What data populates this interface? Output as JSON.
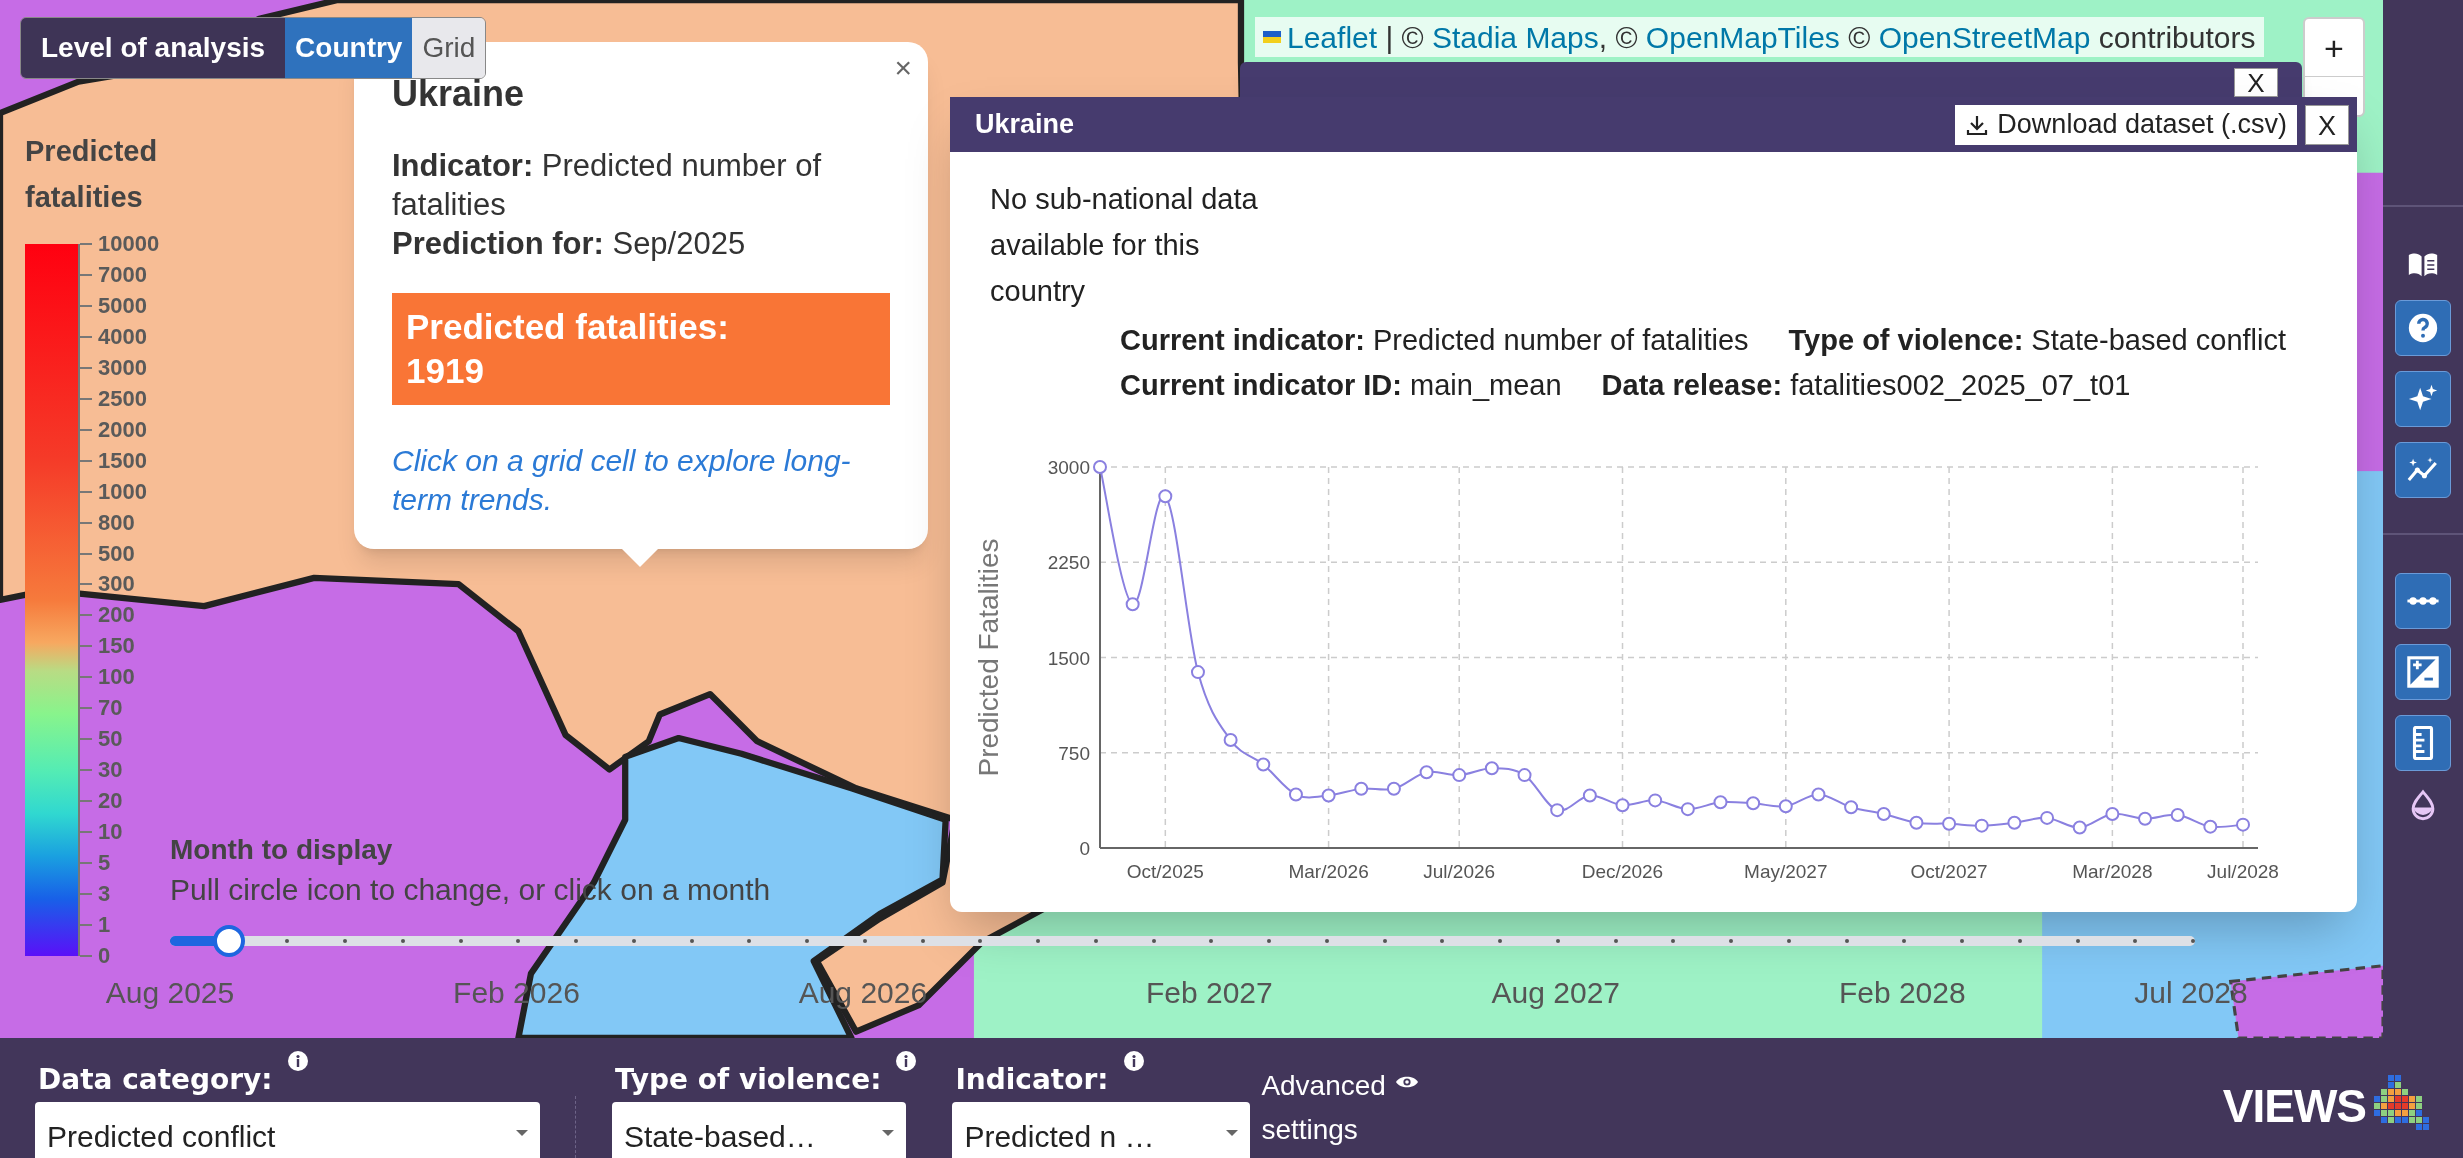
{
  "level_of_analysis": {
    "label": "Level of analysis",
    "options": [
      {
        "label": "Country",
        "selected": true
      },
      {
        "label": "Grid",
        "selected": false
      }
    ]
  },
  "legend": {
    "title": "Predicted fatalities",
    "labels": [
      "10000",
      "7000",
      "5000",
      "4000",
      "3000",
      "2500",
      "2000",
      "1500",
      "1000",
      "800",
      "500",
      "300",
      "200",
      "150",
      "100",
      "70",
      "50",
      "30",
      "20",
      "10",
      "5",
      "3",
      "1",
      "0"
    ]
  },
  "popup": {
    "title": "Ukraine",
    "close": "×",
    "lines": [
      "**Indicator:** Predicted number of fatalities",
      "**Prediction for:** Sep/2025"
    ],
    "highlight": {
      "label": "Predicted fatalities:",
      "value": "1919"
    },
    "link": "Click on a grid cell to explore long-term trends."
  },
  "attribution": [
    {
      "kind": "link",
      "text": "Leaflet"
    },
    {
      "kind": "text",
      "text": " | © "
    },
    {
      "kind": "link",
      "text": "Stadia Maps"
    },
    {
      "kind": "text",
      "text": ", © "
    },
    {
      "kind": "link",
      "text": "OpenMapTiles"
    },
    {
      "kind": "text",
      "text": " © "
    },
    {
      "kind": "link",
      "text": "OpenStreetMap"
    },
    {
      "kind": "text",
      "text": " contributors"
    }
  ],
  "zoom_in": "+",
  "back_panel": {
    "close": "X"
  },
  "chart_panel": {
    "title": "Ukraine",
    "download": "Download dataset (.csv)",
    "close": "X",
    "note": "No sub-national data available for this country",
    "info_rows": [
      [
        "**Current indicator:** Predicted number of fatalities",
        "**Type of violence:** State-based conflict"
      ],
      [
        "**Current indicator ID:** main_mean",
        "**Data release:** fatalities002_2025_07_t01"
      ]
    ],
    "chart_data": {
      "type": "line",
      "ylabel": "Predicted Fatalities",
      "categories": [
        null,
        null,
        "Oct/2025",
        null,
        null,
        null,
        null,
        "Mar/2026",
        null,
        null,
        null,
        "Jul/2026",
        null,
        null,
        null,
        null,
        "Dec/2026",
        null,
        null,
        null,
        null,
        "May/2027",
        null,
        null,
        null,
        null,
        "Oct/2027",
        null,
        null,
        null,
        null,
        "Mar/2028",
        null,
        null,
        null,
        "Jul/2028"
      ],
      "series": [
        {
          "color": "#8a80e0",
          "marker": "circle",
          "values": [
            3000,
            1919,
            2770,
            1385,
            850,
            658,
            421,
            413,
            467,
            467,
            597,
            574,
            628,
            574,
            298,
            413,
            337,
            375,
            306,
            360,
            352,
            329,
            421,
            321,
            268,
            199,
            191,
            176,
            199,
            237,
            161,
            268,
            230,
            260,
            168,
            184
          ]
        }
      ],
      "ylim": [
        0,
        3000
      ],
      "yticks": [
        0,
        750,
        1500,
        2250,
        3000
      ],
      "grid": true
    }
  },
  "month_slider": {
    "title": "Month to display",
    "hint": "Pull circle icon to change, or click on a month",
    "level": 0.029,
    "labels": [
      "Aug 2025",
      "Feb 2026",
      "Aug 2026",
      "Feb 2027",
      "Aug 2027",
      "Feb 2028",
      "Jul 2028"
    ]
  },
  "toolbar": {
    "groups": [
      [
        {
          "kind": "book"
        },
        {
          "kind": "help"
        },
        {
          "kind": "sparkle"
        },
        {
          "kind": "trend"
        }
      ],
      [
        {
          "kind": "dots"
        },
        {
          "kind": "exposure"
        },
        {
          "kind": "ruler"
        },
        {
          "kind": "drop"
        }
      ]
    ]
  },
  "filters": [
    {
      "kind": "select",
      "label": "Data category:",
      "value": "Predicted conflict"
    },
    {
      "kind": "divider"
    },
    {
      "kind": "select",
      "label": "Type of violence:",
      "value": "State-based…"
    },
    {
      "kind": "select",
      "label": "Indicator:",
      "value": "Predicted n …"
    },
    {
      "kind": "toggle",
      "label": "Advanced settings"
    }
  ],
  "logo": "VIEWS"
}
